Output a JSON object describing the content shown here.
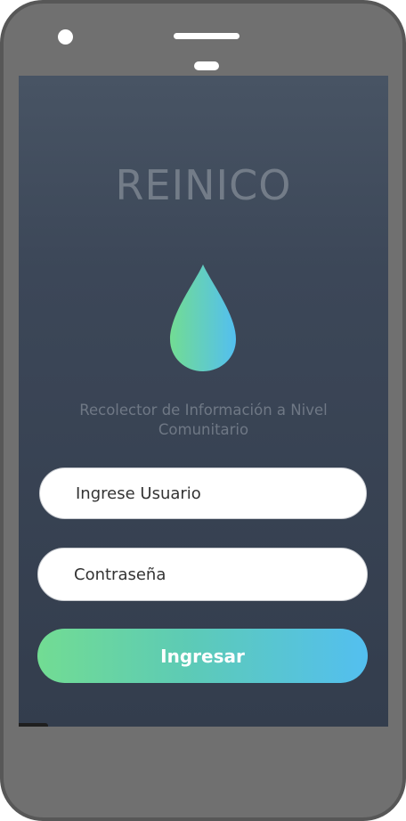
{
  "app": {
    "title": "REINICO",
    "subtitle": "Recolector de Información a Nivel Comunitario"
  },
  "form": {
    "username_placeholder": "Ingrese Usuario",
    "password_placeholder": "Contraseña",
    "submit_label": "Ingresar"
  },
  "icons": {
    "logo": "water-drop-icon"
  },
  "colors": {
    "phone_frame": "#707070",
    "screen_top": "#485464",
    "screen_bottom": "#333d4d",
    "gradient_start": "#72dc93",
    "gradient_end": "#53bff0",
    "title_text": "#737c88"
  }
}
